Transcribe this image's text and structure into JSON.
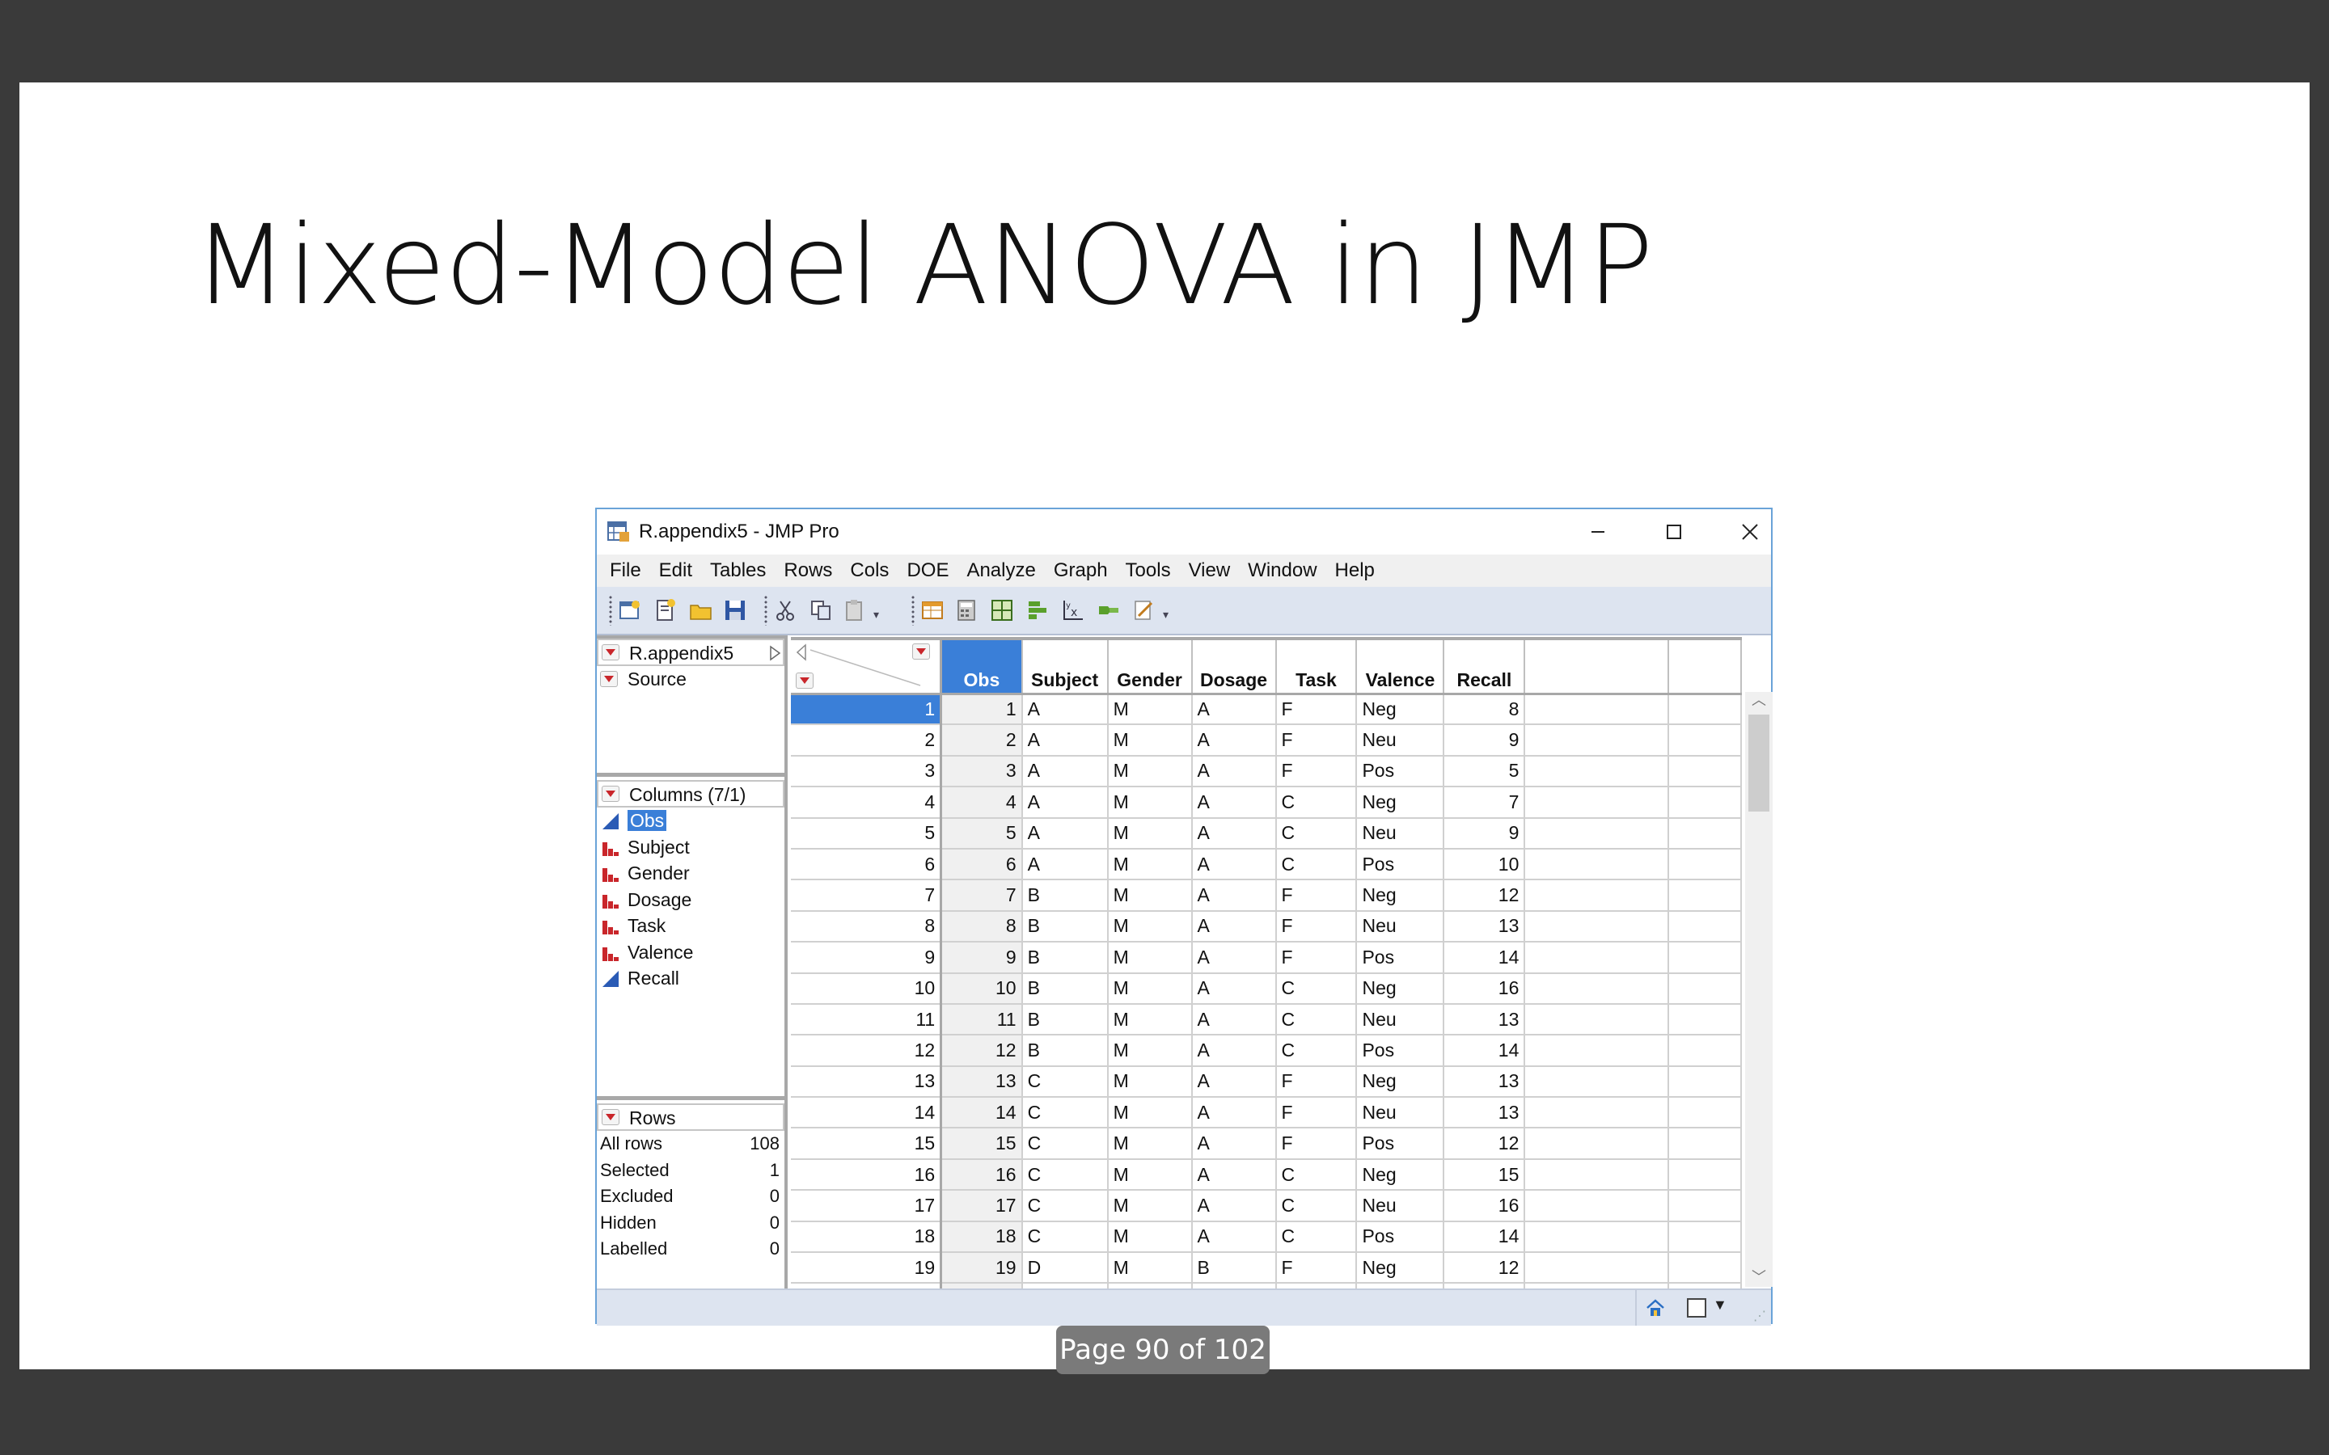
{
  "slide": {
    "title": "Mixed-Model ANOVA in JMP",
    "page_indicator": "Page 90 of 102"
  },
  "window": {
    "title": "R.appendix5 - JMP Pro",
    "menu": [
      "File",
      "Edit",
      "Tables",
      "Rows",
      "Cols",
      "DOE",
      "Analyze",
      "Graph",
      "Tools",
      "View",
      "Window",
      "Help"
    ]
  },
  "table_panel": {
    "name": "R.appendix5",
    "source": "Source"
  },
  "columns_panel": {
    "header": "Columns (7/1)",
    "items": [
      {
        "label": "Obs",
        "type": "continuous"
      },
      {
        "label": "Subject",
        "type": "nominal"
      },
      {
        "label": "Gender",
        "type": "nominal"
      },
      {
        "label": "Dosage",
        "type": "nominal"
      },
      {
        "label": "Task",
        "type": "nominal"
      },
      {
        "label": "Valence",
        "type": "nominal"
      },
      {
        "label": "Recall",
        "type": "continuous"
      }
    ]
  },
  "rows_panel": {
    "header": "Rows",
    "stats": [
      {
        "label": "All rows",
        "value": "108"
      },
      {
        "label": "Selected",
        "value": "1"
      },
      {
        "label": "Excluded",
        "value": "0"
      },
      {
        "label": "Hidden",
        "value": "0"
      },
      {
        "label": "Labelled",
        "value": "0"
      }
    ]
  },
  "grid": {
    "headers": [
      "Obs",
      "Subject",
      "Gender",
      "Dosage",
      "Task",
      "Valence",
      "Recall"
    ],
    "rows": [
      [
        "1",
        "1",
        "A",
        "M",
        "A",
        "F",
        "Neg",
        "8"
      ],
      [
        "2",
        "2",
        "A",
        "M",
        "A",
        "F",
        "Neu",
        "9"
      ],
      [
        "3",
        "3",
        "A",
        "M",
        "A",
        "F",
        "Pos",
        "5"
      ],
      [
        "4",
        "4",
        "A",
        "M",
        "A",
        "C",
        "Neg",
        "7"
      ],
      [
        "5",
        "5",
        "A",
        "M",
        "A",
        "C",
        "Neu",
        "9"
      ],
      [
        "6",
        "6",
        "A",
        "M",
        "A",
        "C",
        "Pos",
        "10"
      ],
      [
        "7",
        "7",
        "B",
        "M",
        "A",
        "F",
        "Neg",
        "12"
      ],
      [
        "8",
        "8",
        "B",
        "M",
        "A",
        "F",
        "Neu",
        "13"
      ],
      [
        "9",
        "9",
        "B",
        "M",
        "A",
        "F",
        "Pos",
        "14"
      ],
      [
        "10",
        "10",
        "B",
        "M",
        "A",
        "C",
        "Neg",
        "16"
      ],
      [
        "11",
        "11",
        "B",
        "M",
        "A",
        "C",
        "Neu",
        "13"
      ],
      [
        "12",
        "12",
        "B",
        "M",
        "A",
        "C",
        "Pos",
        "14"
      ],
      [
        "13",
        "13",
        "C",
        "M",
        "A",
        "F",
        "Neg",
        "13"
      ],
      [
        "14",
        "14",
        "C",
        "M",
        "A",
        "F",
        "Neu",
        "13"
      ],
      [
        "15",
        "15",
        "C",
        "M",
        "A",
        "F",
        "Pos",
        "12"
      ],
      [
        "16",
        "16",
        "C",
        "M",
        "A",
        "C",
        "Neg",
        "15"
      ],
      [
        "17",
        "17",
        "C",
        "M",
        "A",
        "C",
        "Neu",
        "16"
      ],
      [
        "18",
        "18",
        "C",
        "M",
        "A",
        "C",
        "Pos",
        "14"
      ],
      [
        "19",
        "19",
        "D",
        "M",
        "B",
        "F",
        "Neg",
        "12"
      ],
      [
        "",
        "",
        "",
        "",
        "",
        "",
        "",
        ""
      ]
    ]
  },
  "colors": {
    "selection": "#3a7fd8",
    "nominal_icon": "#c9262b",
    "continuous_icon": "#2a5bb5",
    "toolbar": "#dde4f0"
  }
}
